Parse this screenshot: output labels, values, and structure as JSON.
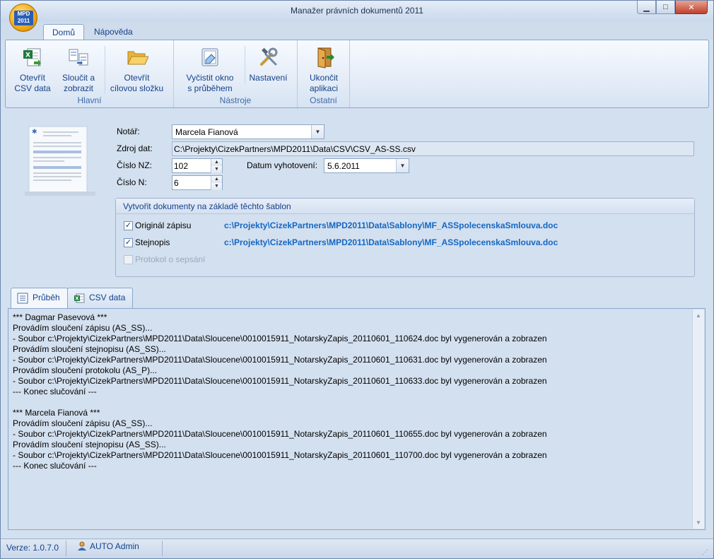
{
  "window": {
    "title": "Manažer právních dokumentů 2011",
    "logo_text": "MPD 2011",
    "minimize": "▁",
    "maximize": "□",
    "close": "✕"
  },
  "ribbon": {
    "tabs": [
      {
        "label": "Domů",
        "active": true
      },
      {
        "label": "Nápověda",
        "active": false
      }
    ],
    "groups": [
      {
        "label": "Hlavní",
        "buttons": [
          {
            "label_line1": "Otevřít",
            "label_line2": "CSV data",
            "icon": "excel-open-icon"
          },
          {
            "label_line1": "Sloučit a",
            "label_line2": "zobrazit",
            "icon": "merge-documents-icon"
          },
          {
            "label_line1": "Otevřít",
            "label_line2": "cílovou složku",
            "icon": "folder-open-icon"
          }
        ]
      },
      {
        "label": "Nástroje",
        "buttons": [
          {
            "label_line1": "Vyčistit okno",
            "label_line2": "s průběhem",
            "icon": "eraser-icon"
          },
          {
            "label_line1": "Nastavení",
            "label_line2": "",
            "icon": "tools-icon"
          }
        ]
      },
      {
        "label": "Ostatní",
        "buttons": [
          {
            "label_line1": "Ukončit",
            "label_line2": "aplikaci",
            "icon": "exit-door-icon"
          }
        ]
      }
    ]
  },
  "form": {
    "notar_label": "Notář:",
    "notar_value": "Marcela Fianová",
    "zdroj_label": "Zdroj dat:",
    "zdroj_value": "C:\\Projekty\\CizekPartners\\MPD2011\\Data\\CSV\\CSV_AS-SS.csv",
    "cislo_nz_label": "Číslo NZ:",
    "cislo_nz_value": "102",
    "datum_label": "Datum vyhotovení:",
    "datum_value": "5.6.2011",
    "cislo_n_label": "Číslo N:",
    "cislo_n_value": "6"
  },
  "templates": {
    "header": "Vytvořit dokumenty na základě těchto šablon",
    "items": [
      {
        "label": "Originál zápisu",
        "checked": true,
        "enabled": true,
        "path": "c:\\Projekty\\CizekPartners\\MPD2011\\Data\\Sablony\\MF_ASSpolecenskaSmlouva.doc"
      },
      {
        "label": "Stejnopis",
        "checked": true,
        "enabled": true,
        "path": "c:\\Projekty\\CizekPartners\\MPD2011\\Data\\Sablony\\MF_ASSpolecenskaSmlouva.doc"
      },
      {
        "label": "Protokol o sepsání",
        "checked": false,
        "enabled": false,
        "path": ""
      }
    ]
  },
  "bottom_tabs": [
    {
      "label": "Průběh",
      "active": true,
      "icon": "log-list-icon"
    },
    {
      "label": "CSV data",
      "active": false,
      "icon": "excel-grid-icon"
    }
  ],
  "log_lines": [
    "*** Dagmar Pasevová ***",
    "Provádím sloučení zápisu (AS_SS)...",
    "- Soubor c:\\Projekty\\CizekPartners\\MPD2011\\Data\\Sloucene\\0010015911_NotarskyZapis_20110601_110624.doc byl vygenerován a zobrazen",
    "Provádím sloučení stejnopisu (AS_SS)...",
    "- Soubor c:\\Projekty\\CizekPartners\\MPD2011\\Data\\Sloucene\\0010015911_NotarskyZapis_20110601_110631.doc byl vygenerován a zobrazen",
    "Provádím sloučení protokolu (AS_P)...",
    "- Soubor c:\\Projekty\\CizekPartners\\MPD2011\\Data\\Sloucene\\0010015911_NotarskyZapis_20110601_110633.doc byl vygenerován a zobrazen",
    "--- Konec slučování ---",
    "",
    "*** Marcela Fianová ***",
    "Provádím sloučení zápisu (AS_SS)...",
    "- Soubor c:\\Projekty\\CizekPartners\\MPD2011\\Data\\Sloucene\\0010015911_NotarskyZapis_20110601_110655.doc byl vygenerován a zobrazen",
    "Provádím sloučení stejnopisu (AS_SS)...",
    "- Soubor c:\\Projekty\\CizekPartners\\MPD2011\\Data\\Sloucene\\0010015911_NotarskyZapis_20110601_110700.doc byl vygenerován a zobrazen",
    "--- Konec slučování ---"
  ],
  "statusbar": {
    "version": "Verze: 1.0.7.0",
    "user": "AUTO Admin"
  },
  "colors": {
    "accent": "#15428b",
    "link": "#1467c4",
    "background": "#d3e0ef"
  }
}
